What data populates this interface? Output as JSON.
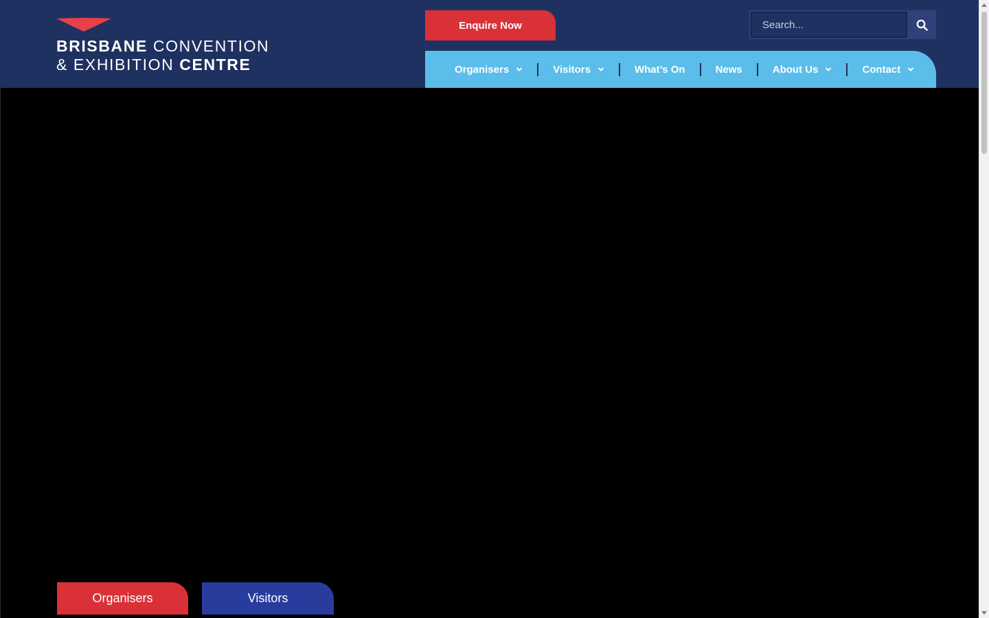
{
  "brand": {
    "line1_bold": "BRISBANE",
    "line1_light": "CONVENTION",
    "line2_light": "& EXHIBITION",
    "line2_bold": "CENTRE"
  },
  "header": {
    "enquire_label": "Enquire Now"
  },
  "search": {
    "placeholder": "Search...",
    "button_icon": "search-icon"
  },
  "nav": {
    "items": [
      {
        "label": "Organisers",
        "has_dropdown": true
      },
      {
        "label": "Visitors",
        "has_dropdown": true
      },
      {
        "label": "What’s On",
        "has_dropdown": false
      },
      {
        "label": "News",
        "has_dropdown": false
      },
      {
        "label": "About Us",
        "has_dropdown": true
      },
      {
        "label": "Contact",
        "has_dropdown": true
      }
    ]
  },
  "hero": {
    "buttons": {
      "organisers": "Organisers",
      "visitors": "Visitors"
    }
  },
  "colors": {
    "header_bg": "#1f3160",
    "accent_red": "#da3038",
    "nav_bg": "#5bbde9",
    "visitors_blue": "#283c9e"
  }
}
